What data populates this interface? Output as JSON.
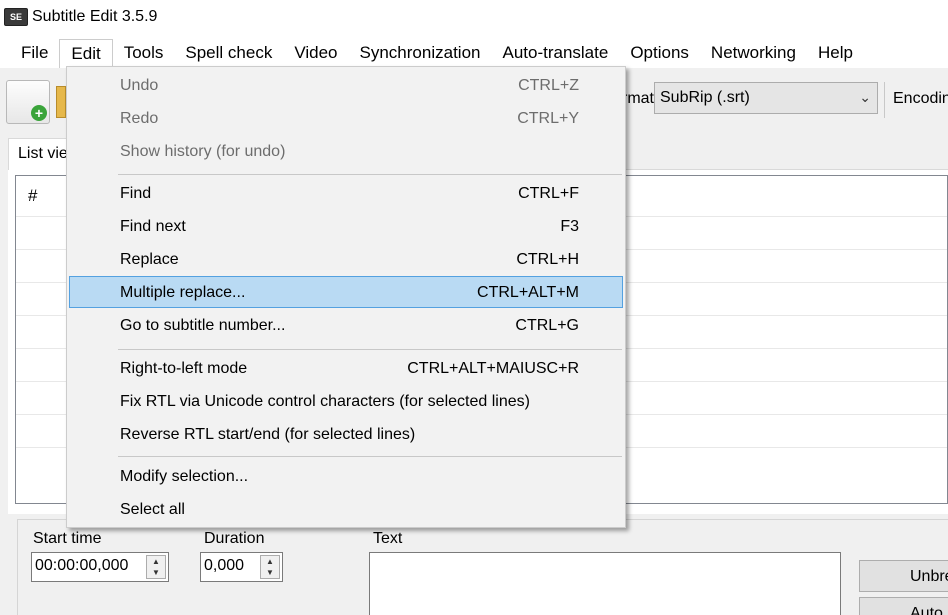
{
  "window": {
    "title": "Subtitle Edit 3.5.9",
    "icon_text": "SE"
  },
  "menubar": {
    "items": [
      {
        "label": "File"
      },
      {
        "label": "Edit"
      },
      {
        "label": "Tools"
      },
      {
        "label": "Spell check"
      },
      {
        "label": "Video"
      },
      {
        "label": "Synchronization"
      },
      {
        "label": "Auto-translate"
      },
      {
        "label": "Options"
      },
      {
        "label": "Networking"
      },
      {
        "label": "Help"
      }
    ]
  },
  "toolbar": {
    "format_label": "Format",
    "format_value": "SubRip (.srt)",
    "encoding_label": "Encoding"
  },
  "tabs": {
    "list_view": "List view"
  },
  "listview": {
    "col_number": "#"
  },
  "edit_panel": {
    "start_time_label": "Start time",
    "start_time_value": "00:00:00,000",
    "duration_label": "Duration",
    "duration_value": "0,000",
    "text_label": "Text",
    "unbreak_button": "Unbreak",
    "auto_button": "Auto br"
  },
  "edit_menu": {
    "items": [
      {
        "label": "Undo",
        "shortcut": "CTRL+Z",
        "enabled": false
      },
      {
        "label": "Redo",
        "shortcut": "CTRL+Y",
        "enabled": false
      },
      {
        "label": "Show history (for undo)",
        "shortcut": "",
        "enabled": false
      },
      {
        "label": "Find",
        "shortcut": "CTRL+F",
        "enabled": true
      },
      {
        "label": "Find next",
        "shortcut": "F3",
        "enabled": true
      },
      {
        "label": "Replace",
        "shortcut": "CTRL+H",
        "enabled": true
      },
      {
        "label": "Multiple replace...",
        "shortcut": "CTRL+ALT+M",
        "enabled": true,
        "highlighted": true
      },
      {
        "label": "Go to subtitle number...",
        "shortcut": "CTRL+G",
        "enabled": true
      },
      {
        "label": "Right-to-left mode",
        "shortcut": "CTRL+ALT+MAIUSC+R",
        "enabled": true
      },
      {
        "label": "Fix RTL via Unicode control characters (for selected lines)",
        "shortcut": "",
        "enabled": true
      },
      {
        "label": "Reverse RTL start/end (for selected lines)",
        "shortcut": "",
        "enabled": true
      },
      {
        "label": "Modify selection...",
        "shortcut": "",
        "enabled": true
      },
      {
        "label": "Select all",
        "shortcut": "",
        "enabled": true
      }
    ]
  },
  "colors": {
    "highlight": "#b9daf3",
    "highlight_border": "#54a1e0",
    "disabled_text": "#6d6d6d"
  }
}
